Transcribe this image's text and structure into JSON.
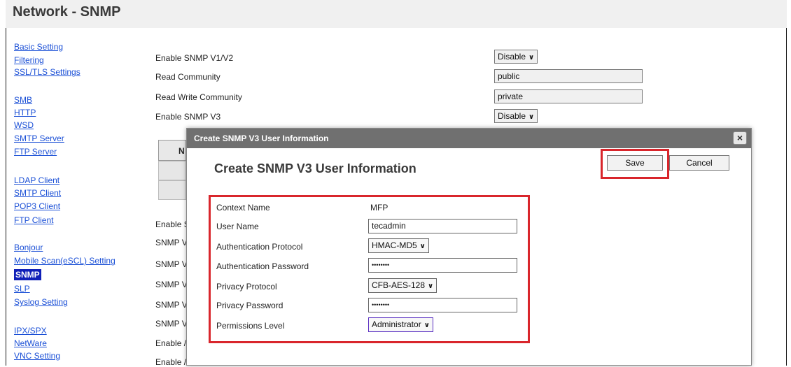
{
  "page": {
    "title": "Network - SNMP"
  },
  "sidebar": {
    "items": [
      {
        "label": "Basic Setting",
        "active": false
      },
      {
        "label": "Filtering",
        "active": false
      },
      {
        "label": "SSL/TLS Settings",
        "active": false
      },
      {
        "label": "SMB",
        "active": false
      },
      {
        "label": "HTTP",
        "active": false
      },
      {
        "label": "WSD",
        "active": false
      },
      {
        "label": "SMTP Server",
        "active": false
      },
      {
        "label": "FTP Server",
        "active": false
      },
      {
        "label": "LDAP Client",
        "active": false
      },
      {
        "label": "SMTP Client",
        "active": false
      },
      {
        "label": "POP3 Client",
        "active": false
      },
      {
        "label": "FTP Client",
        "active": false
      },
      {
        "label": "Bonjour",
        "active": false
      },
      {
        "label": "Mobile Scan(eSCL) Setting",
        "active": false
      },
      {
        "label": "SNMP",
        "active": true
      },
      {
        "label": "SLP",
        "active": false
      },
      {
        "label": "Syslog Setting",
        "active": false
      },
      {
        "label": "IPX/SPX",
        "active": false
      },
      {
        "label": "NetWare",
        "active": false
      },
      {
        "label": "VNC Setting",
        "active": false
      }
    ]
  },
  "form": {
    "enable_v1v2": {
      "label": "Enable SNMP V1/V2",
      "value": "Disable"
    },
    "read_community": {
      "label": "Read Community",
      "value": "public"
    },
    "read_write_community": {
      "label": "Read Write Community",
      "value": "private"
    },
    "enable_v3": {
      "label": "Enable SNMP V3",
      "value": "Disable"
    },
    "partial_labels": [
      "Enable S",
      "SNMP V",
      "SNMP V",
      "SNMP V",
      "SNMP V",
      "SNMP V",
      "Enable /",
      "Enable /"
    ],
    "partial_button": "N"
  },
  "modal": {
    "bar_title": "Create SNMP V3 User Information",
    "close_glyph": "×",
    "heading": "Create SNMP V3 User Information",
    "save_label": "Save",
    "cancel_label": "Cancel",
    "context_name": {
      "label": "Context Name",
      "value": "MFP"
    },
    "user_name": {
      "label": "User Name",
      "value": "tecadmin"
    },
    "auth_protocol": {
      "label": "Authentication Protocol",
      "value": "HMAC-MD5"
    },
    "auth_password": {
      "label": "Authentication Password",
      "value": "••••••••"
    },
    "privacy_protocol": {
      "label": "Privacy Protocol",
      "value": "CFB-AES-128"
    },
    "privacy_password": {
      "label": "Privacy Password",
      "value": "••••••••"
    },
    "permissions_level": {
      "label": "Permissions Level",
      "value": "Administrator"
    }
  },
  "icons": {
    "dropdown": "chevron-down-icon",
    "close": "close-icon"
  },
  "colors": {
    "highlight": "#d9262c",
    "link": "#1a4fd6",
    "active_nav": "#1020b8",
    "modal_bar": "#707070"
  }
}
